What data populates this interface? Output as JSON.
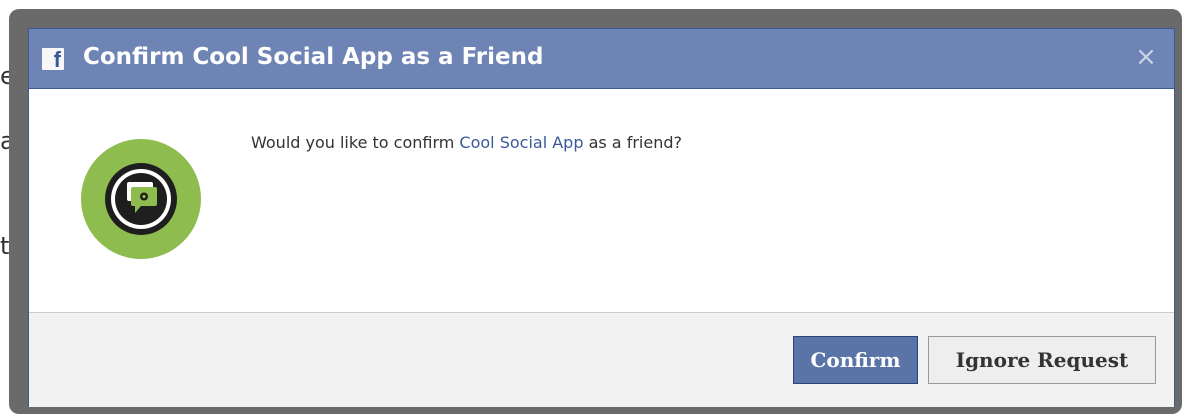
{
  "background_fragments": [
    "e",
    "al",
    "tc"
  ],
  "dialog": {
    "title": "Confirm Cool Social App as a Friend",
    "logo_letter": "f",
    "close_glyph": "×",
    "message_prefix": "Would you like to confirm ",
    "app_name": "Cool Social App",
    "message_suffix": " as a friend?",
    "confirm_label": "Confirm",
    "ignore_label": "Ignore Request"
  },
  "colors": {
    "titlebar": "#6d84b4",
    "link": "#3b5998",
    "confirm_button": "#5b74a8",
    "app_icon_ring": "#8fbc4e"
  }
}
